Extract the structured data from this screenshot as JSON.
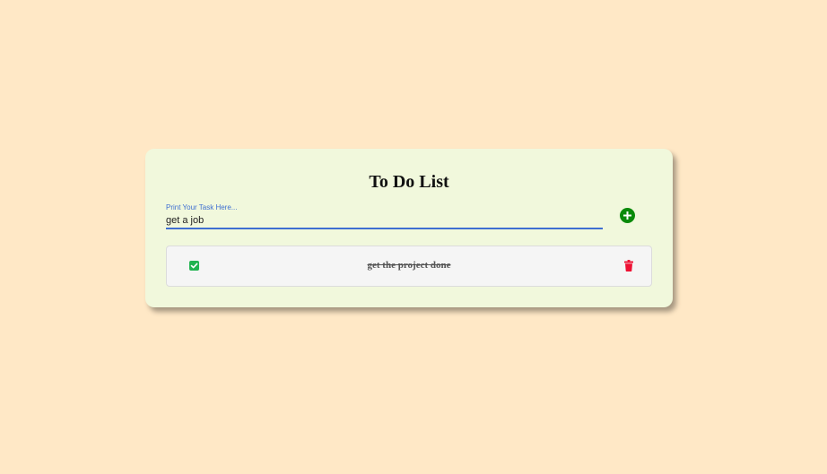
{
  "app": {
    "title": "To Do List"
  },
  "input": {
    "label": "Print Your Task Here...",
    "value": "get a job"
  },
  "add_button": {
    "icon": "plus-circle-icon",
    "color": "#0a8a0a"
  },
  "todos": [
    {
      "text": "get the project done",
      "completed": true,
      "check_color": "#21b34f",
      "delete_icon": "trash-icon",
      "delete_color": "#ee1133"
    }
  ],
  "colors": {
    "background": "#ffe8c6",
    "card": "#f1f8dc",
    "accent": "#3f6fd1"
  }
}
